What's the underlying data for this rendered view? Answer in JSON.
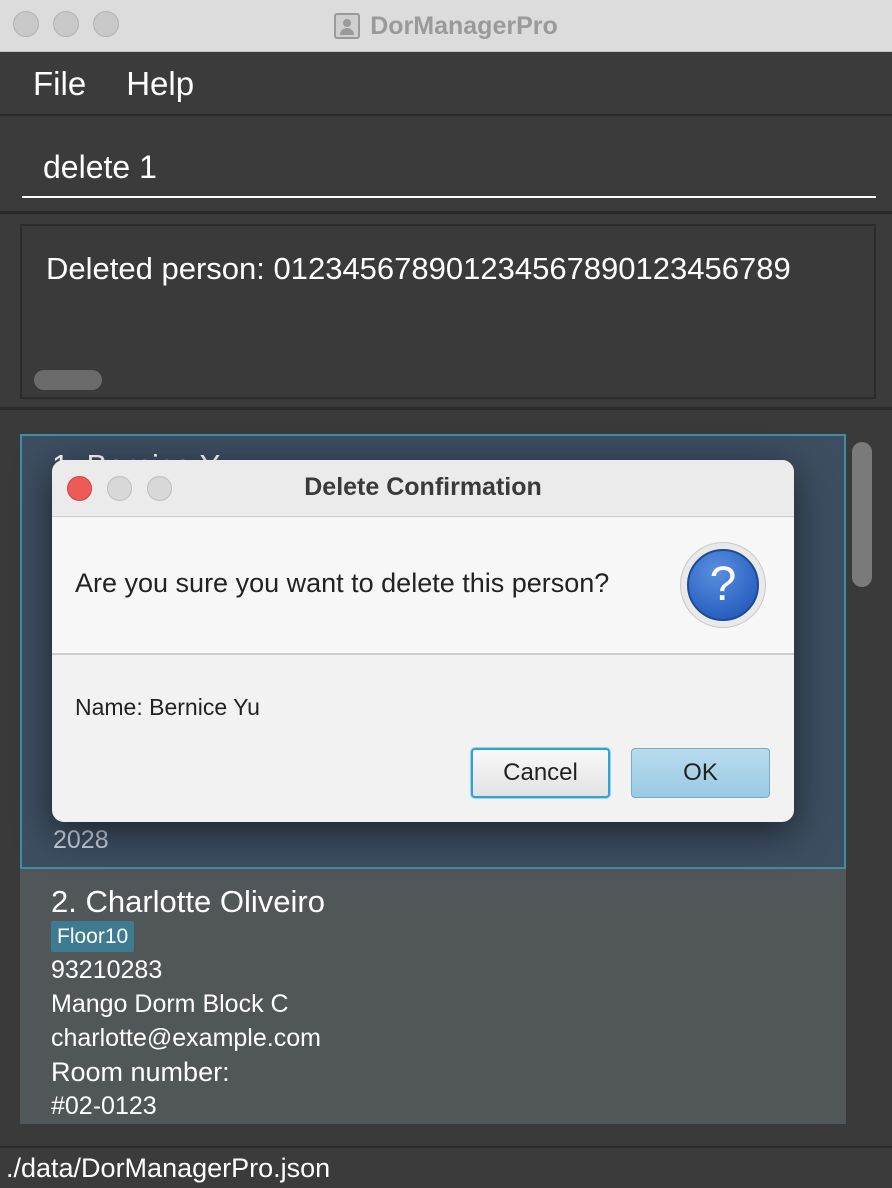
{
  "window": {
    "title": "DorManagerPro",
    "app_icon": "person-card-icon"
  },
  "menu": {
    "items": [
      "File",
      "Help"
    ]
  },
  "command": {
    "value": "delete 1"
  },
  "result": {
    "text": "Deleted person: 012345678901234567890123456789"
  },
  "persons": [
    {
      "index_name": "1. Bernice Yu",
      "last_line": "2028"
    },
    {
      "index_name": "2. Charlotte Oliveiro",
      "tag": "Floor10",
      "phone": "93210283",
      "address": "Mango Dorm Block C",
      "email": "charlotte@example.com",
      "room_label": "Room number:",
      "room_value": "#02-0123"
    }
  ],
  "status": {
    "file_path": "./data/DorManagerPro.json"
  },
  "dialog": {
    "title": "Delete Confirmation",
    "header": "Are you sure you want to delete this person?",
    "icon": "question-icon",
    "content": "Name: Bernice Yu",
    "cancel_label": "Cancel",
    "ok_label": "OK"
  },
  "colors": {
    "background": "#3a3a3a",
    "selected_card": "#3d4e61",
    "selected_border": "#3f8da8",
    "card": "#515658",
    "tag": "#3e7b91",
    "ok_button": "#a9d3ea",
    "focus_ring": "#2fa3d6",
    "close_button": "#ec5b56"
  }
}
